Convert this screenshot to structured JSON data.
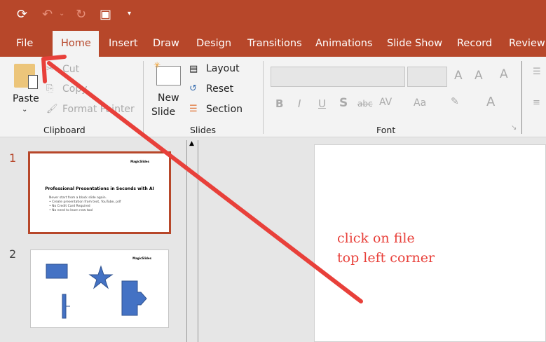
{
  "quick_access": {
    "icons": [
      "autosave-icon",
      "undo-icon",
      "redo-icon",
      "present-icon",
      "customize-icon"
    ]
  },
  "tabs": [
    "File",
    "Home",
    "Insert",
    "Draw",
    "Design",
    "Transitions",
    "Animations",
    "Slide Show",
    "Record",
    "Review"
  ],
  "active_tab": "Home",
  "clipboard": {
    "paste": "Paste",
    "cut": "Cut",
    "copy": "Copy",
    "format_painter": "Format Painter",
    "group": "Clipboard"
  },
  "slides_group": {
    "new_slide_1": "New",
    "new_slide_2": "Slide",
    "layout": "Layout",
    "reset": "Reset",
    "section": "Section",
    "group": "Slides"
  },
  "font_group": {
    "group": "Font",
    "bold": "B",
    "italic": "I",
    "underline": "U",
    "shadow": "S",
    "strike": "abc",
    "spacing": "AV",
    "case": "Aa",
    "font_color": "A"
  },
  "thumbnails": [
    {
      "number": "1",
      "logo": "MagicSlides",
      "title": "Professional Presentations in Seconds with AI",
      "subtitle": "Never start from a black slide again.",
      "bullets": [
        "• Create presentation from text, YouTube, pdf",
        "• No Credit Card Required",
        "• No need to learn new tool"
      ]
    },
    {
      "number": "2",
      "logo": "MagicSlides"
    }
  ],
  "annotation": {
    "line1": "click on file",
    "line2": "top left corner",
    "color": "#e8403a"
  }
}
